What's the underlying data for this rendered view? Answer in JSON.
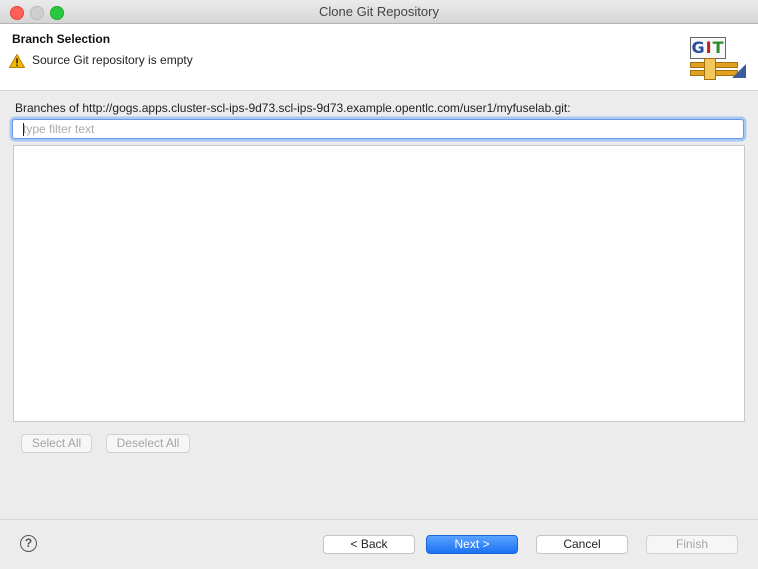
{
  "window": {
    "title": "Clone Git Repository"
  },
  "header": {
    "title": "Branch Selection",
    "message": "Source Git repository is empty",
    "message_icon": "warning-icon",
    "logo_text": {
      "g": "G",
      "i": "I",
      "t": "T"
    }
  },
  "main": {
    "branches_label": "Branches of http://gogs.apps.cluster-scl-ips-9d73.scl-ips-9d73.example.opentlc.com/user1/myfuselab.git:",
    "filter": {
      "placeholder": "type filter text",
      "value": ""
    },
    "branches": [],
    "select_all_label": "Select All",
    "deselect_all_label": "Deselect All"
  },
  "footer": {
    "help_symbol": "?",
    "back_label": "< Back",
    "next_label": "Next >",
    "cancel_label": "Cancel",
    "finish_label": "Finish"
  },
  "colors": {
    "accent": "#1b72f2",
    "warning": "#f2b705",
    "close": "#fe5f57",
    "maximize": "#28c940"
  }
}
